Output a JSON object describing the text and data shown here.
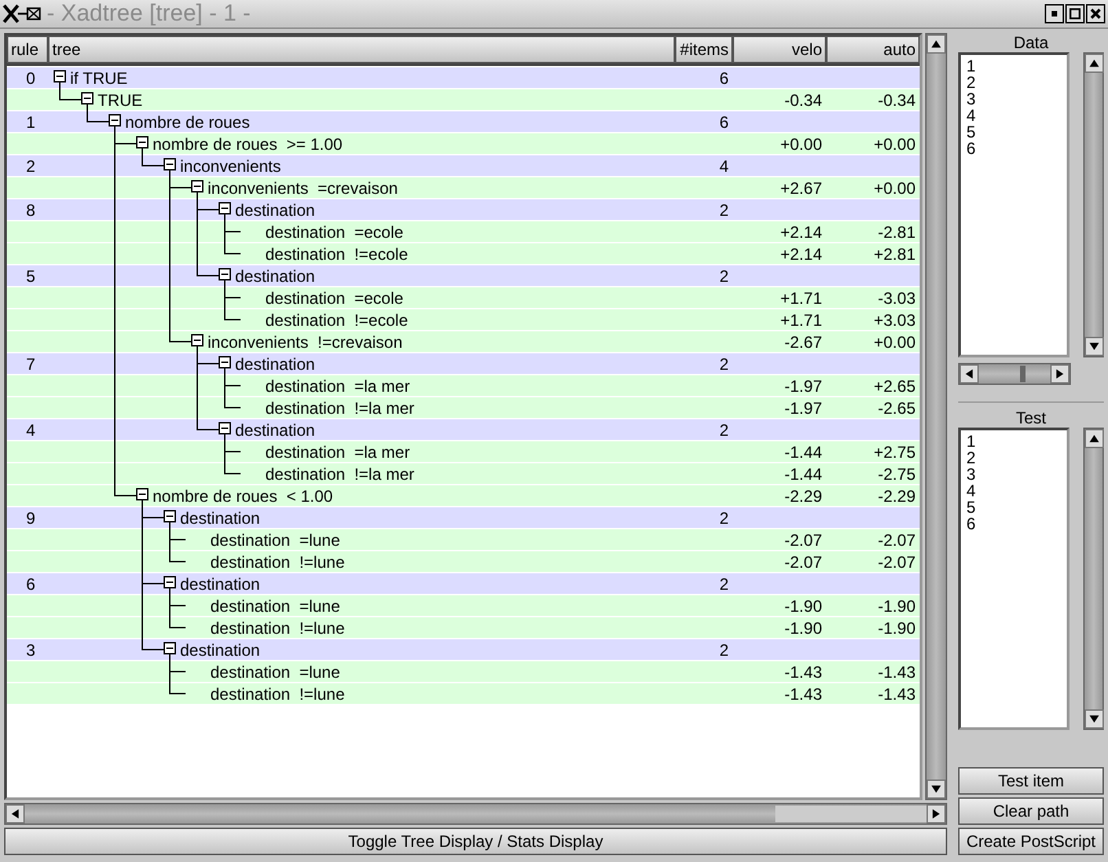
{
  "window": {
    "title": "- Xadtree [tree] - 1 -"
  },
  "table": {
    "columns": [
      "rule",
      "tree",
      "#items",
      "velo",
      "auto"
    ],
    "tree": [
      {
        "kind": "split",
        "rule": "0",
        "label": "if TRUE",
        "items": "6",
        "children": [
          {
            "kind": "branch",
            "label": "TRUE",
            "velo": "-0.34",
            "auto": "-0.34",
            "children": [
              {
                "kind": "split",
                "rule": "1",
                "label": "nombre de roues",
                "items": "6",
                "children": [
                  {
                    "kind": "branch",
                    "label": "nombre de roues  >= 1.00",
                    "velo": "+0.00",
                    "auto": "+0.00",
                    "children": [
                      {
                        "kind": "split",
                        "rule": "2",
                        "label": "inconvenients",
                        "items": "4",
                        "children": [
                          {
                            "kind": "branch",
                            "label": "inconvenients  =crevaison",
                            "velo": "+2.67",
                            "auto": "+0.00",
                            "children": [
                              {
                                "kind": "split",
                                "rule": "8",
                                "label": "destination",
                                "items": "2",
                                "children": [
                                  {
                                    "kind": "branch",
                                    "label": "destination  =ecole",
                                    "velo": "+2.14",
                                    "auto": "-2.81"
                                  },
                                  {
                                    "kind": "branch",
                                    "label": "destination  !=ecole",
                                    "velo": "+2.14",
                                    "auto": "+2.81"
                                  }
                                ]
                              },
                              {
                                "kind": "split",
                                "rule": "5",
                                "label": "destination",
                                "items": "2",
                                "children": [
                                  {
                                    "kind": "branch",
                                    "label": "destination  =ecole",
                                    "velo": "+1.71",
                                    "auto": "-3.03"
                                  },
                                  {
                                    "kind": "branch",
                                    "label": "destination  !=ecole",
                                    "velo": "+1.71",
                                    "auto": "+3.03"
                                  }
                                ]
                              }
                            ]
                          },
                          {
                            "kind": "branch",
                            "label": "inconvenients  !=crevaison",
                            "velo": "-2.67",
                            "auto": "+0.00",
                            "children": [
                              {
                                "kind": "split",
                                "rule": "7",
                                "label": "destination",
                                "items": "2",
                                "children": [
                                  {
                                    "kind": "branch",
                                    "label": "destination  =la mer",
                                    "velo": "-1.97",
                                    "auto": "+2.65"
                                  },
                                  {
                                    "kind": "branch",
                                    "label": "destination  !=la mer",
                                    "velo": "-1.97",
                                    "auto": "-2.65"
                                  }
                                ]
                              },
                              {
                                "kind": "split",
                                "rule": "4",
                                "label": "destination",
                                "items": "2",
                                "children": [
                                  {
                                    "kind": "branch",
                                    "label": "destination  =la mer",
                                    "velo": "-1.44",
                                    "auto": "+2.75"
                                  },
                                  {
                                    "kind": "branch",
                                    "label": "destination  !=la mer",
                                    "velo": "-1.44",
                                    "auto": "-2.75"
                                  }
                                ]
                              }
                            ]
                          }
                        ]
                      }
                    ]
                  },
                  {
                    "kind": "branch",
                    "label": "nombre de roues  < 1.00",
                    "velo": "-2.29",
                    "auto": "-2.29",
                    "children": [
                      {
                        "kind": "split",
                        "rule": "9",
                        "label": "destination",
                        "items": "2",
                        "children": [
                          {
                            "kind": "branch",
                            "label": "destination  =lune",
                            "velo": "-2.07",
                            "auto": "-2.07"
                          },
                          {
                            "kind": "branch",
                            "label": "destination  !=lune",
                            "velo": "-2.07",
                            "auto": "-2.07"
                          }
                        ]
                      },
                      {
                        "kind": "split",
                        "rule": "6",
                        "label": "destination",
                        "items": "2",
                        "children": [
                          {
                            "kind": "branch",
                            "label": "destination  =lune",
                            "velo": "-1.90",
                            "auto": "-1.90"
                          },
                          {
                            "kind": "branch",
                            "label": "destination  !=lune",
                            "velo": "-1.90",
                            "auto": "-1.90"
                          }
                        ]
                      },
                      {
                        "kind": "split",
                        "rule": "3",
                        "label": "destination",
                        "items": "2",
                        "children": [
                          {
                            "kind": "branch",
                            "label": "destination  =lune",
                            "velo": "-1.43",
                            "auto": "-1.43"
                          },
                          {
                            "kind": "branch",
                            "label": "destination  !=lune",
                            "velo": "-1.43",
                            "auto": "-1.43"
                          }
                        ]
                      }
                    ]
                  }
                ]
              }
            ]
          }
        ]
      }
    ]
  },
  "toggle_button": "Toggle Tree Display / Stats Display",
  "data_panel": {
    "title": "Data",
    "items": [
      "1",
      "2",
      "3",
      "4",
      "5",
      "6"
    ]
  },
  "test_panel": {
    "title": "Test",
    "items": [
      "1",
      "2",
      "3",
      "4",
      "5",
      "6"
    ]
  },
  "buttons": [
    "Test item",
    "Clear path",
    "Create PostScript"
  ]
}
